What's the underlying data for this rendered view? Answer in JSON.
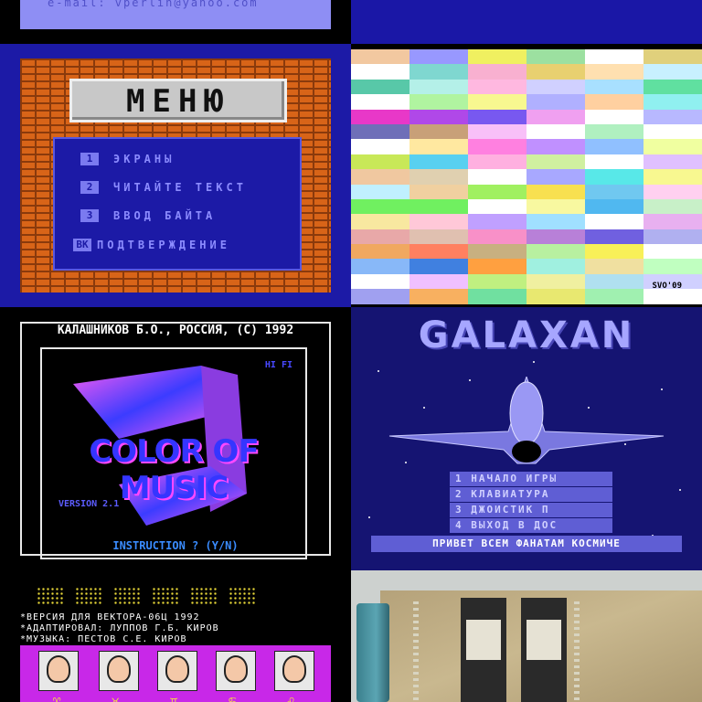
{
  "email_tile": {
    "text": "e-mail: vperlin@yahoo.com"
  },
  "menu_tile": {
    "title": "МЕНЮ",
    "items": [
      {
        "key": "1",
        "label": "ЭКРАНЫ"
      },
      {
        "key": "2",
        "label": "ЧИТАЙТЕ ТЕКСТ"
      },
      {
        "key": "3",
        "label": "ВВОД БАЙТА"
      },
      {
        "key": "ВК",
        "label": "ПОДТВЕРЖДЕНИЕ"
      }
    ]
  },
  "palette_tile": {
    "signature": "SVO'09",
    "colors": [
      [
        "#f2c8a0",
        "#9898ff",
        "#f0f060",
        "#9ce0a0",
        "#ffffff",
        "#e0d07c"
      ],
      [
        "#ffffff",
        "#7fd7d0",
        "#f8b0d0",
        "#e8d070",
        "#ffe0b0",
        "#c8f0ff"
      ],
      [
        "#58c8a8",
        "#b4f0e8",
        "#ffb8e0",
        "#d0d0ff",
        "#a8e0ff",
        "#60e0a0"
      ],
      [
        "#ffffff",
        "#b0f4a0",
        "#f8f890",
        "#b0b0ff",
        "#ffd0a0",
        "#90f0f0"
      ],
      [
        "#e838c8",
        "#b048e8",
        "#7858f0",
        "#f0a0f0",
        "#ffffff",
        "#b8b8ff"
      ],
      [
        "#6f6fb8",
        "#c8a078",
        "#f8c0f8",
        "#ffffff",
        "#b0f0c0",
        "#ffffff"
      ],
      [
        "#ffffff",
        "#ffe8a0",
        "#ff80e0",
        "#c090ff",
        "#90c0ff",
        "#f0ffa0"
      ],
      [
        "#c8e858",
        "#58d0f0",
        "#ffb0e0",
        "#d0f0a0",
        "#ffffff",
        "#e0c0ff"
      ],
      [
        "#f0c8a0",
        "#e0d0b0",
        "#ffffff",
        "#a8a8ff",
        "#58e8e8",
        "#f8f890"
      ],
      [
        "#c0f0ff",
        "#f0d0a0",
        "#a0f060",
        "#f8e050",
        "#70c8f0",
        "#ffd0f0"
      ],
      [
        "#70f060",
        "#70f060",
        "#ffffff",
        "#f8f8a0",
        "#50b8f0",
        "#c8f0c8"
      ],
      [
        "#f8e8a0",
        "#ffc8d8",
        "#c0a0ff",
        "#a0e0ff",
        "#ffffff",
        "#e8b0f0"
      ],
      [
        "#e8a8a8",
        "#e0c0b0",
        "#f890c8",
        "#b880d8",
        "#7060e0",
        "#b0b0f0"
      ],
      [
        "#f0a860",
        "#ff8060",
        "#c8b080",
        "#b8f0a0",
        "#f8f058",
        "#ffffff"
      ],
      [
        "#88b8f8",
        "#4080e0",
        "#ffa040",
        "#a0f0e0",
        "#f0e0a0",
        "#c0ffc0"
      ],
      [
        "#ffffff",
        "#f0c0ff",
        "#c0f080",
        "#f0f0a0",
        "#b0e0f0",
        "#d0d0ff"
      ],
      [
        "#a0a0f0",
        "#f8b060",
        "#70e0a0",
        "#e8e870",
        "#a0f0b0",
        "#ffffff"
      ]
    ]
  },
  "color_of_music_tile": {
    "header": "КАЛАШНИКОВ Б.О., РОССИЯ, (С) 1992",
    "hifi": "HI FI",
    "logo": "COLOR OF MUSIC",
    "version": "VERSION 2.1",
    "instruction": "INSTRUCTION ? (Y/N)"
  },
  "galaxan_tile": {
    "title": "GALAXAN",
    "menu": [
      "1 НАЧАЛО ИГРЫ",
      "2 КЛАВИАТУРА",
      "3 ДЖОИСТИК П",
      "4 ВЫХОД В ДОС"
    ],
    "bottom": "ПРИВЕТ ВСЕМ ФАНАТАМ КОСМИЧЕ"
  },
  "vector_tile": {
    "lines": [
      "*ВЕРСИЯ ДЛЯ ВЕКТОРА-06Ц 1992",
      "*АДАПТИРОВАЛ: ЛУППОВ Г.Б. КИРОВ",
      "*МУЗЫКА: ПЕСТОВ С.Е. КИРОВ"
    ],
    "glyphs": [
      "♈",
      "♉",
      "♊",
      "♋",
      "♌"
    ]
  }
}
